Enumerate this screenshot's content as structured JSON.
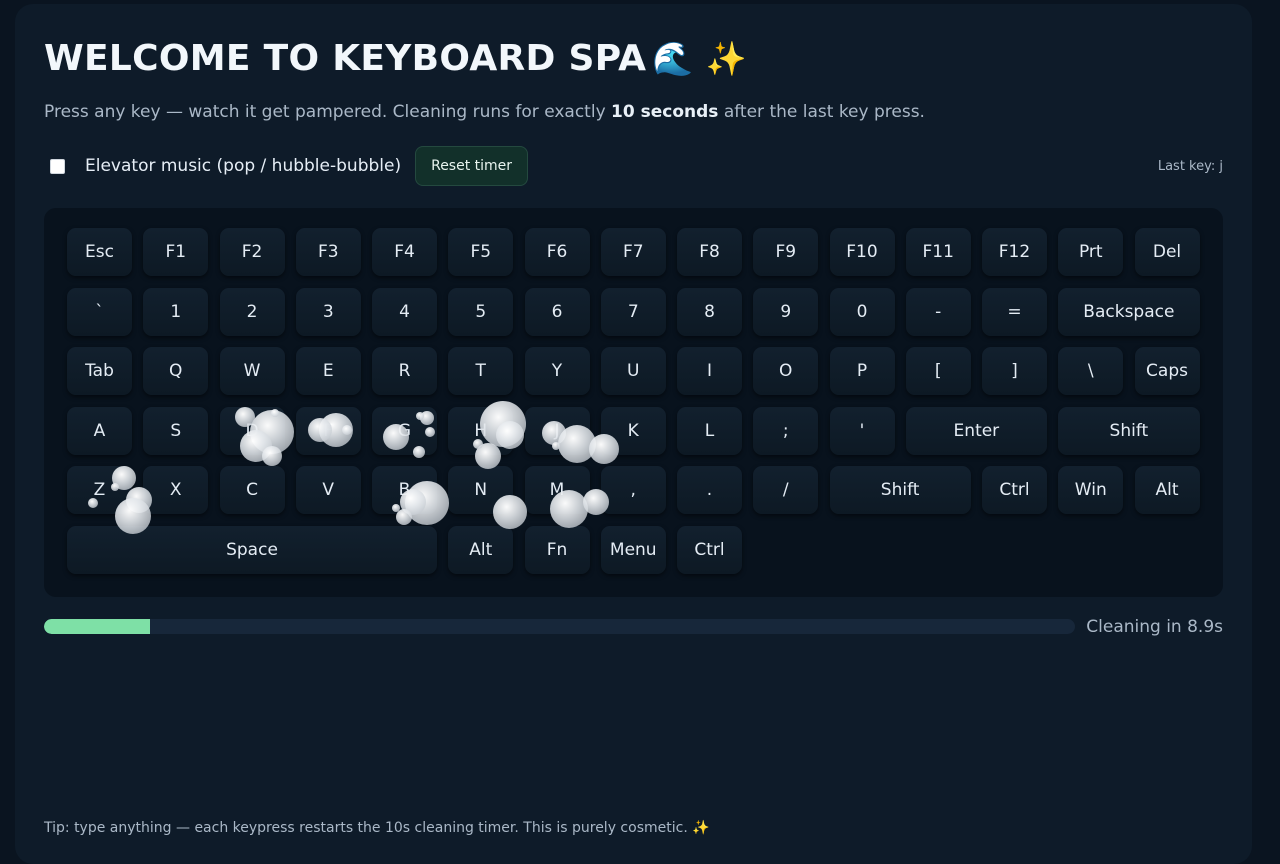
{
  "title": "WELCOME TO KEYBOARD SPA",
  "title_emoji": "🌊 ✨",
  "subtitle": {
    "before": "Press any key — watch it get pampered. Cleaning runs for exactly ",
    "bold": "10 seconds",
    "after": " after the last key press."
  },
  "music_checkbox": {
    "checked": false,
    "label": "Elevator music (pop / hubble-bubble)"
  },
  "reset_button": "Reset timer",
  "last_key": "Last key: j",
  "keyboard": {
    "rows": [
      [
        "Esc",
        "F1",
        "F2",
        "F3",
        "F4",
        "F5",
        "F6",
        "F7",
        "F8",
        "F9",
        "F10",
        "F11",
        "F12",
        "Prt",
        "Del"
      ],
      [
        "`",
        "1",
        "2",
        "3",
        "4",
        "5",
        "6",
        "7",
        "8",
        "9",
        "0",
        "-",
        "=",
        "Backspace"
      ],
      [
        "Tab",
        "Q",
        "W",
        "E",
        "R",
        "T",
        "Y",
        "U",
        "I",
        "O",
        "P",
        "[",
        "]",
        "\\",
        "Caps"
      ],
      [
        "A",
        "S",
        "D",
        "F",
        "G",
        "H",
        "J",
        "K",
        "L",
        ";",
        "'",
        "Enter",
        "Shift"
      ],
      [
        "Z",
        "X",
        "C",
        "V",
        "B",
        "N",
        "M",
        ",",
        ".",
        "/",
        "Shift",
        "Ctrl",
        "Win",
        "Alt"
      ],
      [
        "Space",
        "Alt",
        "Fn",
        "Menu",
        "Ctrl"
      ]
    ]
  },
  "progress": {
    "fraction": 0.103,
    "label": "Cleaning in 8.9s"
  },
  "tip": "Tip: type anything — each keypress restarts the 10s cleaning timer. This is purely cosmetic. ✨",
  "colors": {
    "page_bg": "#0a1420",
    "card_bg": "#0e1b29",
    "keyboard_bg": "#08121d",
    "progress_fill": "#7ee0a6",
    "progress_track": "#17273a"
  }
}
